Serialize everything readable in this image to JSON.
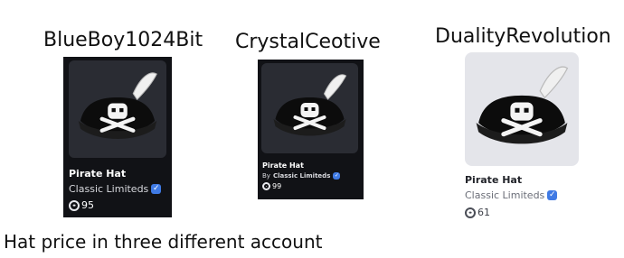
{
  "accounts": [
    {
      "username": "BlueBoy1024Bit",
      "item_name": "Pirate Hat",
      "creator": "Classic Limiteds",
      "by_prefix": "",
      "price": "95",
      "theme": "dark",
      "icon": "pirate-hat-icon",
      "verified_icon": "verified-badge-icon",
      "currency_icon": "robux-icon"
    },
    {
      "username": "CrystalCeotive",
      "item_name": "Pirate Hat",
      "creator": "Classic Limiteds",
      "by_prefix": "By",
      "price": "99",
      "theme": "dark",
      "icon": "pirate-hat-icon",
      "verified_icon": "verified-badge-icon",
      "currency_icon": "robux-icon"
    },
    {
      "username": "DualityRevolution",
      "item_name": "Pirate Hat",
      "creator": "Classic Limiteds",
      "by_prefix": "",
      "price": "61",
      "theme": "light",
      "icon": "pirate-hat-icon",
      "verified_icon": "verified-badge-icon",
      "currency_icon": "robux-icon"
    }
  ],
  "caption": "Hat price in three different account",
  "colors": {
    "dark_card_bg": "#111216",
    "dark_thumb_bg": "#2a2c33",
    "light_thumb_bg": "#e4e5ea",
    "verified_blue": "#3f7ae4"
  },
  "verified_mark": "✓"
}
